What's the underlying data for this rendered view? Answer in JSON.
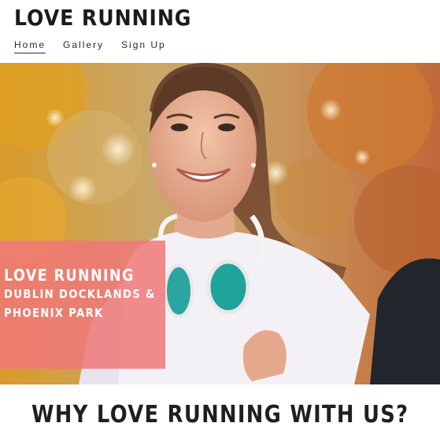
{
  "site": {
    "brand": "LOVE RUNNING"
  },
  "nav": {
    "items": [
      {
        "label": "Home",
        "active": true
      },
      {
        "label": "Gallery",
        "active": false
      },
      {
        "label": "Sign Up",
        "active": false
      }
    ]
  },
  "hero": {
    "overlay": {
      "title": "LOVE RUNNING",
      "line1": "DUBLIN DOCKLANDS &",
      "line2": "PHOENIX PARK"
    },
    "image_subject": "smiling woman runner with headphones in autumn park"
  },
  "section": {
    "heading": "WHY LOVE RUNNING WITH US?"
  },
  "colors": {
    "text_dark": "#1b1b1b",
    "overlay_pink": "#f07878",
    "background": "#ffffff"
  }
}
